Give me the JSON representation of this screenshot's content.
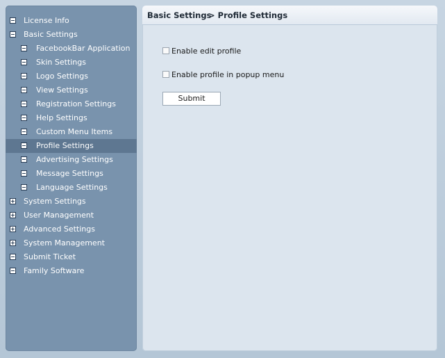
{
  "breadcrumb": {
    "section": "Basic Settings",
    "page": "> Profile Settings"
  },
  "sidebar": {
    "items": [
      {
        "label": "License Info",
        "level": 0,
        "toggle": "minus",
        "selected": false
      },
      {
        "label": "Basic Settings",
        "level": 0,
        "toggle": "minus",
        "selected": false
      },
      {
        "label": "FacebookBar Application",
        "level": 1,
        "toggle": "minus",
        "selected": false
      },
      {
        "label": "Skin Settings",
        "level": 1,
        "toggle": "minus",
        "selected": false
      },
      {
        "label": "Logo Settings",
        "level": 1,
        "toggle": "minus",
        "selected": false
      },
      {
        "label": "View Settings",
        "level": 1,
        "toggle": "minus",
        "selected": false
      },
      {
        "label": "Registration Settings",
        "level": 1,
        "toggle": "minus",
        "selected": false
      },
      {
        "label": "Help Settings",
        "level": 1,
        "toggle": "minus",
        "selected": false
      },
      {
        "label": "Custom Menu Items",
        "level": 1,
        "toggle": "minus",
        "selected": false
      },
      {
        "label": "Profile Settings",
        "level": 1,
        "toggle": "minus",
        "selected": true
      },
      {
        "label": "Advertising Settings",
        "level": 1,
        "toggle": "minus",
        "selected": false
      },
      {
        "label": "Message Settings",
        "level": 1,
        "toggle": "minus",
        "selected": false
      },
      {
        "label": "Language Settings",
        "level": 1,
        "toggle": "minus",
        "selected": false
      },
      {
        "label": "System Settings",
        "level": 0,
        "toggle": "plus",
        "selected": false
      },
      {
        "label": "User Management",
        "level": 0,
        "toggle": "plus",
        "selected": false
      },
      {
        "label": "Advanced Settings",
        "level": 0,
        "toggle": "plus",
        "selected": false
      },
      {
        "label": "System Management",
        "level": 0,
        "toggle": "plus",
        "selected": false
      },
      {
        "label": "Submit Ticket",
        "level": 0,
        "toggle": "minus",
        "selected": false
      },
      {
        "label": "Family Software",
        "level": 0,
        "toggle": "minus",
        "selected": false
      }
    ]
  },
  "form": {
    "enable_edit_profile": {
      "label": "Enable edit profile",
      "checked": false
    },
    "enable_profile_popup": {
      "label": "Enable profile in popup menu",
      "checked": false
    },
    "submit_label": "Submit"
  },
  "colors": {
    "sidebar_bg": "#7993ad",
    "sidebar_selected": "#5e7791",
    "content_bg": "#dce5ee",
    "page_bg": "#b8c9d8"
  }
}
